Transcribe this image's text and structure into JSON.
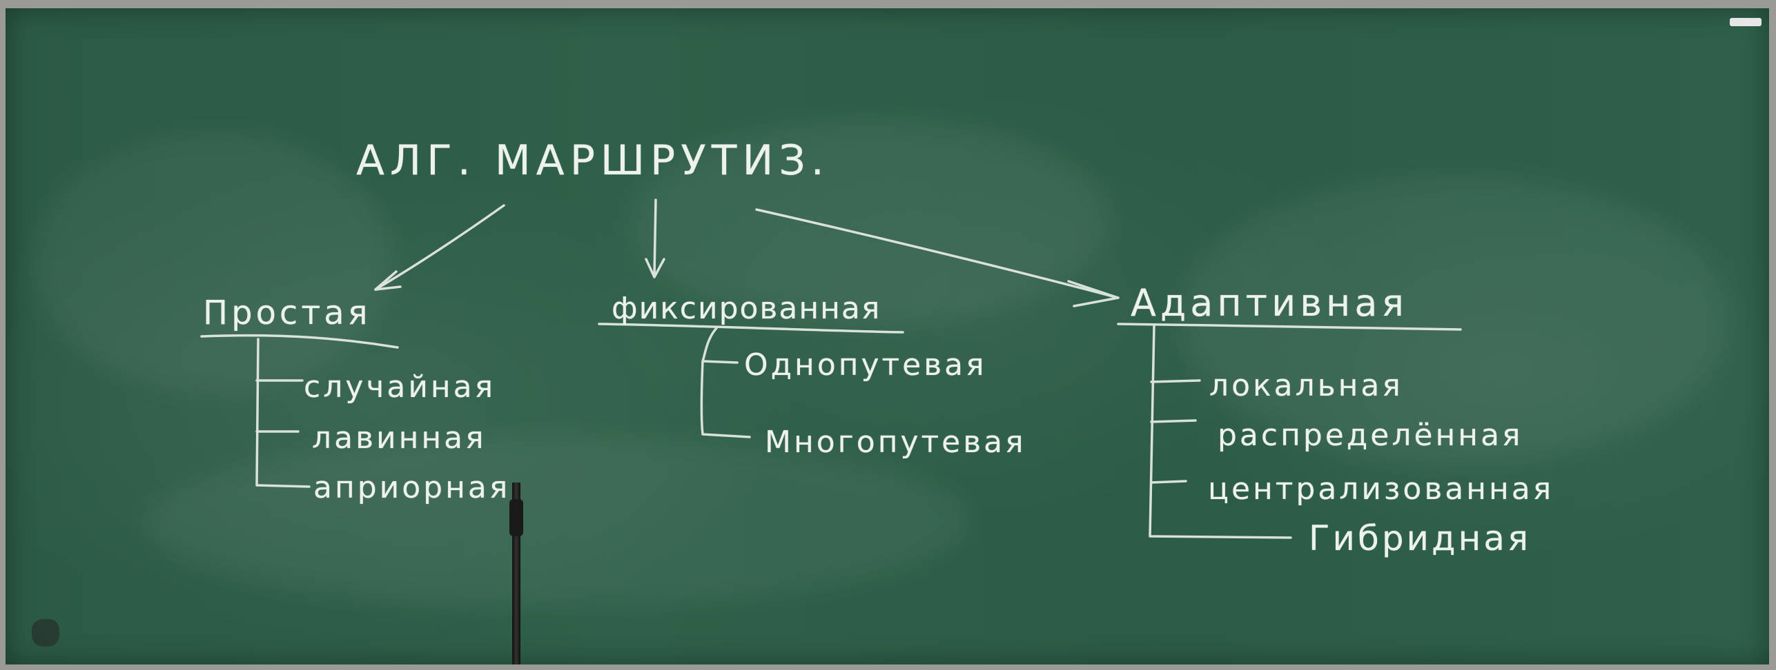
{
  "board": {
    "title": "АЛГ. МАРШРУТИЗ.",
    "branches": [
      {
        "heading": "Простая",
        "items": [
          "случайная",
          "лавинная",
          "априорная"
        ]
      },
      {
        "heading": "фиксированная",
        "items": [
          "Однопутевая",
          "Многопутевая"
        ]
      },
      {
        "heading": "Адаптивная",
        "items": [
          "локальная",
          "распределённая",
          "централизованная",
          "Гибридная"
        ]
      }
    ],
    "colors": {
      "board": "#2e5f48",
      "chalk": "#eef2ec",
      "frame": "#9a9a96"
    }
  }
}
